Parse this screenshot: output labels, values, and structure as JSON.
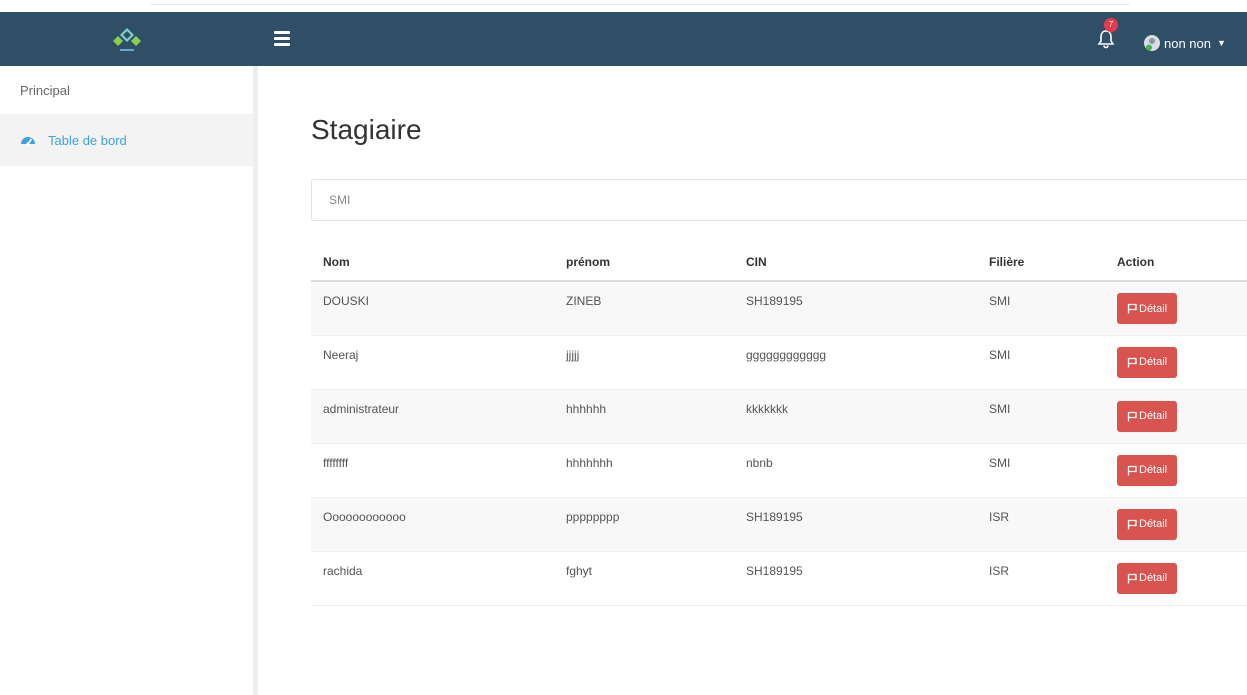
{
  "header": {
    "notification_count": "7",
    "user_name": "non non",
    "colors": {
      "navbar": "#2e4f66",
      "badge": "#e8394a"
    }
  },
  "sidebar": {
    "heading": "Principal",
    "items": [
      {
        "label": "Table de bord",
        "icon": "dashboard-gauge-icon"
      }
    ]
  },
  "main": {
    "title": "Stagiaire",
    "filter_value": "SMI",
    "table": {
      "columns": [
        "Nom",
        "prénom",
        "CIN",
        "Filière",
        "Action"
      ],
      "rows": [
        {
          "nom": "DOUSKI",
          "prenom": "ZINEB",
          "cin": "SH189195",
          "filiere": "SMI",
          "action": "Détail"
        },
        {
          "nom": "Neeraj",
          "prenom": "jjjjj",
          "cin": "gggggggggggg",
          "filiere": "SMI",
          "action": "Détail"
        },
        {
          "nom": "administrateur",
          "prenom": "hhhhhh",
          "cin": "kkkkkkk",
          "filiere": "SMI",
          "action": "Détail"
        },
        {
          "nom": "ffffffff",
          "prenom": "hhhhhhh",
          "cin": "nbnb",
          "filiere": "SMI",
          "action": "Détail"
        },
        {
          "nom": "Oooooooooooo",
          "prenom": "pppppppp",
          "cin": "SH189195",
          "filiere": "ISR",
          "action": "Détail"
        },
        {
          "nom": "rachida",
          "prenom": "fghyt",
          "cin": "SH189195",
          "filiere": "ISR",
          "action": "Détail"
        }
      ]
    },
    "colors": {
      "link": "#3ea2e0",
      "detail_button": "#d9534f"
    }
  }
}
